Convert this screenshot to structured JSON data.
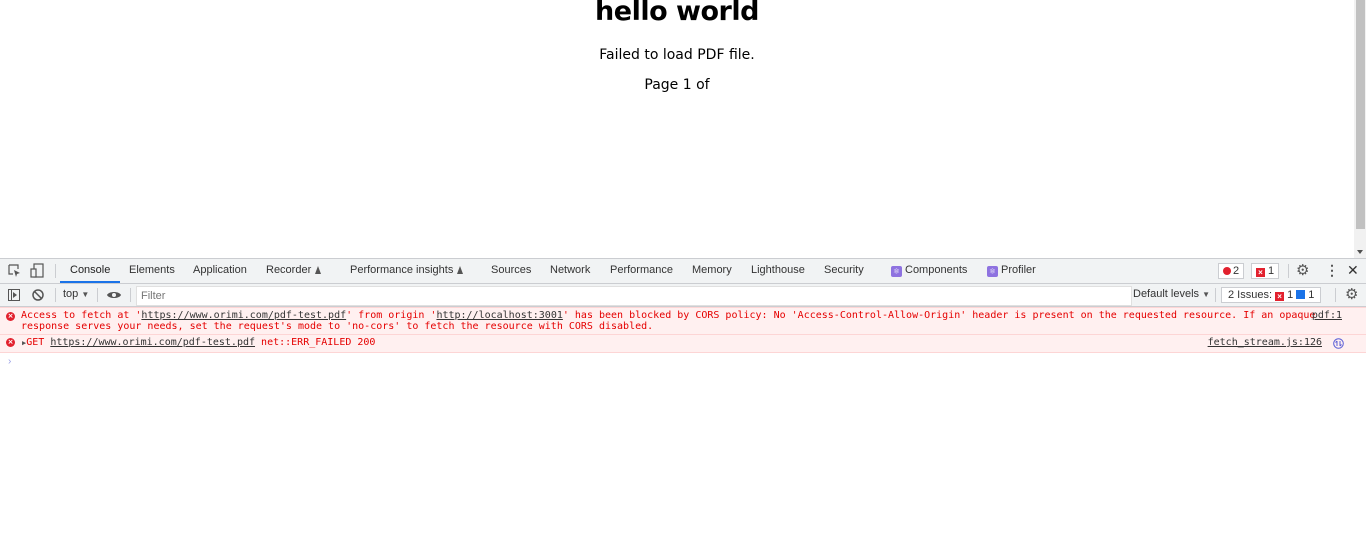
{
  "page": {
    "heading": "hello world",
    "error_message": "Failed to load PDF file.",
    "page_indicator": "Page 1 of"
  },
  "devtools": {
    "tabs": [
      {
        "label": "Console",
        "active": true
      },
      {
        "label": "Elements"
      },
      {
        "label": "Application"
      },
      {
        "label": "Recorder",
        "experimental": true
      },
      {
        "label": "Performance insights",
        "experimental": true
      },
      {
        "label": "Sources"
      },
      {
        "label": "Network"
      },
      {
        "label": "Performance"
      },
      {
        "label": "Memory"
      },
      {
        "label": "Lighthouse"
      },
      {
        "label": "Security"
      },
      {
        "label": "Components",
        "extension": "react"
      },
      {
        "label": "Profiler",
        "extension": "react"
      }
    ],
    "error_count": "2",
    "issue_count": "1",
    "toolbar": {
      "context": "top",
      "filter_placeholder": "Filter",
      "levels": "Default levels",
      "issues_label": "2 Issues:",
      "issues_errors": "1",
      "issues_info": "1"
    },
    "messages": [
      {
        "type": "error",
        "line1_prefix": "Access to fetch at '",
        "url1": "https://www.orimi.com/pdf-test.pdf",
        "line1_mid": "' from origin '",
        "url2": "http://localhost:3001",
        "line1_suffix": "' has been blocked by CORS policy: No 'Access-Control-Allow-Origin' header is present on the requested resource. If an opaque",
        "line2": "response serves your needs, set the request's mode to 'no-cors' to fetch the resource with CORS disabled.",
        "source": "pdf:1"
      },
      {
        "type": "error",
        "method": "GET",
        "url": "https://www.orimi.com/pdf-test.pdf",
        "status": "net::ERR_FAILED 200",
        "source": "fetch_stream.js:126"
      }
    ],
    "prompt_symbol": "›"
  }
}
